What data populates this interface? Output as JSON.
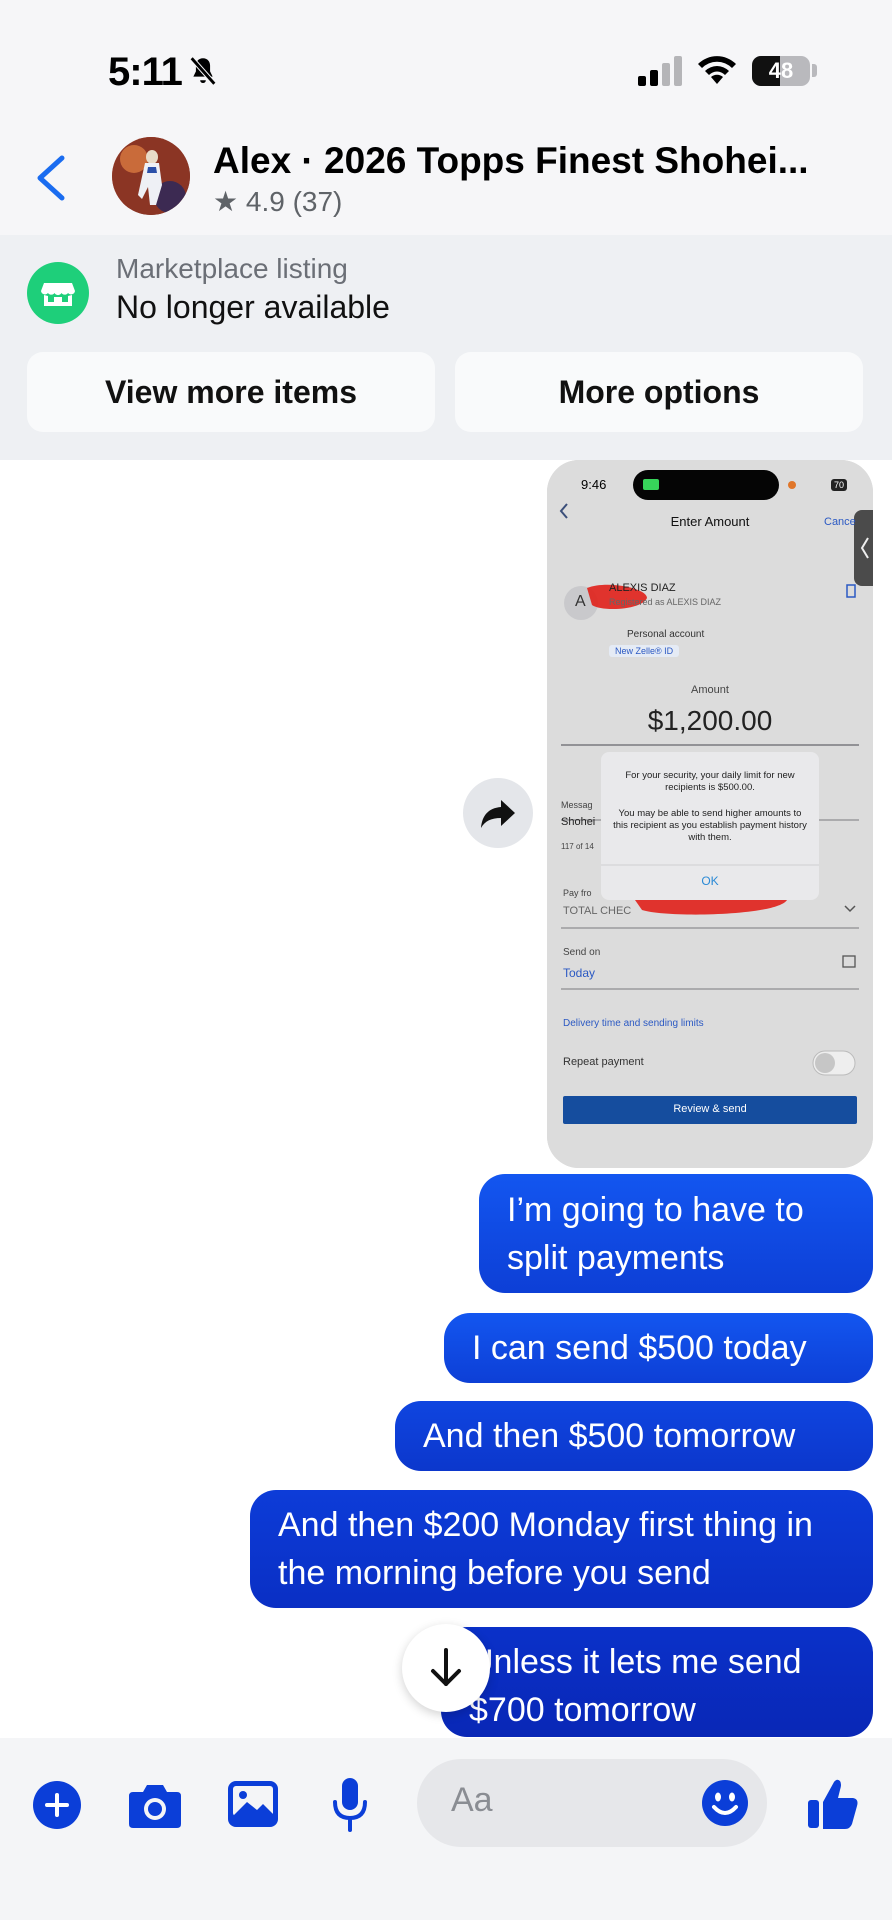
{
  "status_bar": {
    "time": "5:11",
    "battery": "48",
    "battery_level": 0.48
  },
  "header": {
    "title": "Alex · 2026 Topps Finest Shohei...",
    "rating": "★ 4.9 (37)"
  },
  "listing": {
    "label": "Marketplace listing",
    "status": "No longer available",
    "view_more_label": "View more items",
    "more_options_label": "More options"
  },
  "attachment": {
    "time": "9:46",
    "battery": "70",
    "title": "Enter Amount",
    "cancel": "Cance",
    "recipient_initial": "A",
    "recipient_name": "ALEXIS DIAZ",
    "registered": "Registered as ALEXIS DIAZ",
    "account_type": "Personal account",
    "zelle_badge": "New Zelle® ID",
    "amount_label": "Amount",
    "amount": "$1,200.00",
    "message_label": "Messag",
    "message_value": "Shohei",
    "char_count": "117 of 14",
    "pay_from_label": "Pay fro",
    "pay_from_value": "TOTAL CHEC",
    "send_on_label": "Send on",
    "send_on_value": "Today",
    "delivery_link": "Delivery time and sending limits",
    "repeat_label": "Repeat payment",
    "review_button": "Review & send",
    "alert_line1": "For your security, your daily limit for new recipients is $500.00.",
    "alert_line2": "You may be able to send higher amounts to this recipient as you establish payment history with them.",
    "alert_ok": "OK"
  },
  "messages": [
    {
      "text": "I’m going to have to split payments"
    },
    {
      "text": "I can send $500 today"
    },
    {
      "text": "And then $500 tomorrow"
    },
    {
      "text": "And then $200 Monday first thing in the morning before you send"
    },
    {
      "text": "Unless it lets me send $700 tomorrow"
    }
  ],
  "composer": {
    "placeholder": "Aa"
  },
  "colors": {
    "accent": "#1350ee",
    "bubble": "#0d3fd6",
    "marketplace_green": "#1ecf7a"
  },
  "icons": [
    "bell-slash-icon",
    "signal-icon",
    "wifi-icon",
    "battery-icon",
    "back-icon",
    "marketplace-icon",
    "share-icon",
    "scroll-down-icon",
    "plus-icon",
    "camera-icon",
    "gallery-icon",
    "mic-icon",
    "emoji-icon",
    "like-icon"
  ]
}
